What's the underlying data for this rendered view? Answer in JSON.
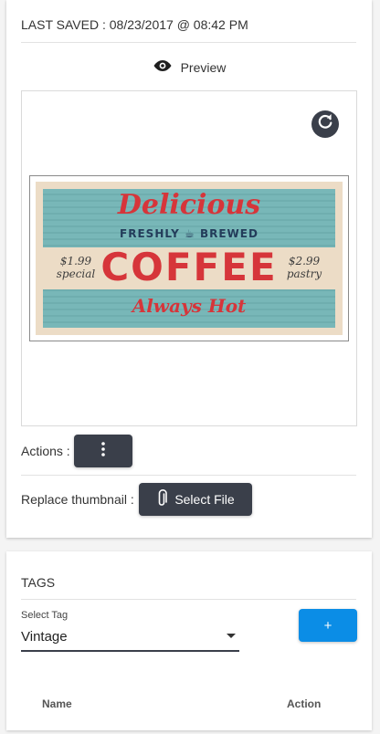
{
  "last_saved": "LAST SAVED : 08/23/2017 @ 08:42 PM",
  "preview": {
    "label": "Preview",
    "icons": {
      "preview": "eye-icon",
      "refresh": "refresh-icon"
    },
    "image": {
      "line1": "Delicious",
      "line2": "FRESHLY ☕ BREWED",
      "line3": "COFFEE",
      "left_price": "$1.99",
      "left_item": "special",
      "right_price": "$2.99",
      "right_item": "pastry",
      "line4": "Always Hot"
    }
  },
  "actions": {
    "label": "Actions :",
    "icon": "more-vertical-icon"
  },
  "replace": {
    "label": "Replace thumbnail :",
    "button_label": "Select File",
    "icon": "paperclip-icon"
  },
  "tags": {
    "heading": "TAGS",
    "select_label": "Select Tag",
    "selected_value": "Vintage",
    "add_label": "+",
    "columns": [
      "Name",
      "Action"
    ]
  },
  "colors": {
    "dark_button": "#3a3f4a",
    "accent": "#0b8de6"
  }
}
